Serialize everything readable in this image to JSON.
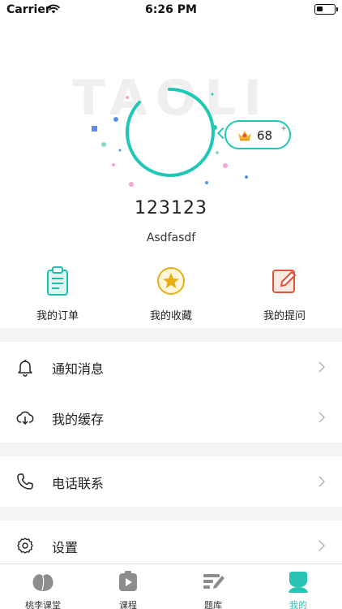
{
  "status_bar": {
    "carrier": "Carrier",
    "time": "6:26 PM"
  },
  "profile": {
    "watermark": "TAOLI",
    "level": "68",
    "username": "123123",
    "nickname": "Asdfasdf",
    "accent_color": "#1fc7b6"
  },
  "quick_actions": [
    {
      "label": "我的订单",
      "icon": "clipboard-icon"
    },
    {
      "label": "我的收藏",
      "icon": "star-icon"
    },
    {
      "label": "我的提问",
      "icon": "edit-icon"
    }
  ],
  "menu": [
    {
      "label": "通知消息",
      "icon": "bell-icon"
    },
    {
      "label": "我的缓存",
      "icon": "cloud-download-icon"
    },
    {
      "label": "电话联系",
      "icon": "phone-icon"
    },
    {
      "label": "设置",
      "icon": "settings-icon"
    }
  ],
  "tabbar": {
    "active_color": "#28c3b3",
    "tabs": [
      {
        "label": "桃李课堂",
        "icon": "peach-icon"
      },
      {
        "label": "课程",
        "icon": "play-icon"
      },
      {
        "label": "题库",
        "icon": "question-bank-icon"
      },
      {
        "label": "我的",
        "icon": "profile-icon"
      }
    ]
  }
}
